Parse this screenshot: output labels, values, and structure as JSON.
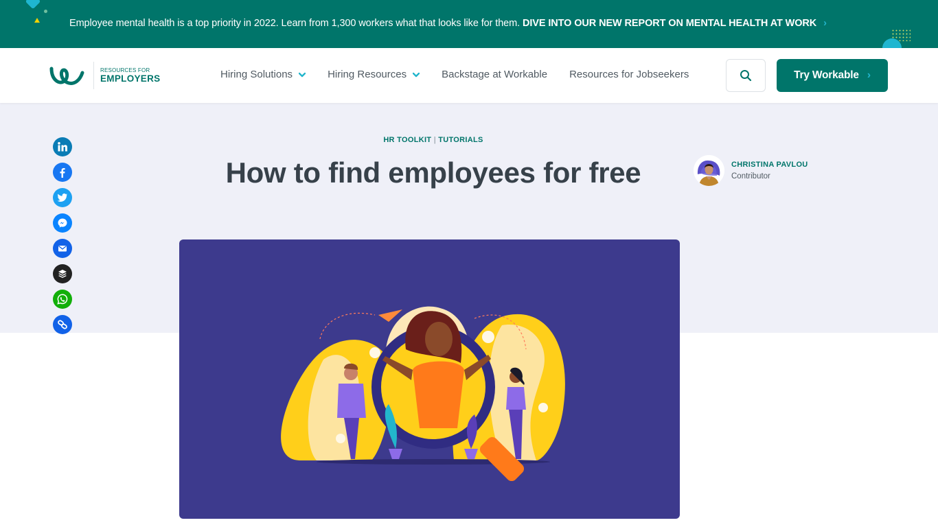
{
  "banner": {
    "text": "Employee mental health is a top priority in 2022. Learn from 1,300 workers what that looks like for them.",
    "cta": "DIVE INTO OUR NEW REPORT ON MENTAL HEALTH AT WORK",
    "chevron": "›"
  },
  "header": {
    "logo": {
      "small": "RESOURCES FOR",
      "big": "EMPLOYERS"
    },
    "nav": [
      {
        "label": "Hiring Solutions",
        "has_dropdown": true
      },
      {
        "label": "Hiring Resources",
        "has_dropdown": true
      },
      {
        "label": "Backstage at Workable",
        "has_dropdown": false
      },
      {
        "label": "Resources for Jobseekers",
        "has_dropdown": false
      }
    ],
    "search_icon": "search-icon",
    "cta_label": "Try Workable",
    "cta_chevron": "›"
  },
  "share": [
    {
      "name": "linkedin",
      "color": "#0a7cb5"
    },
    {
      "name": "facebook",
      "color": "#1877f2"
    },
    {
      "name": "twitter",
      "color": "#1da1f2"
    },
    {
      "name": "messenger",
      "color": "#0a84ff"
    },
    {
      "name": "email",
      "color": "#1262e8"
    },
    {
      "name": "buffer",
      "color": "#222222"
    },
    {
      "name": "whatsapp",
      "color": "#12af0a"
    },
    {
      "name": "copy-link",
      "color": "#1262e8"
    }
  ],
  "article": {
    "category_1": "HR TOOLKIT",
    "category_sep": "|",
    "category_2": "TUTORIALS",
    "title": "How to find employees for free",
    "author_name": "CHRISTINA PAVLOU",
    "author_role": "Contributor"
  },
  "colors": {
    "brand": "#00756a",
    "accent": "#22b5cc",
    "hero_bg": "#eff0f8",
    "image_bg": "#3d3a8d"
  }
}
